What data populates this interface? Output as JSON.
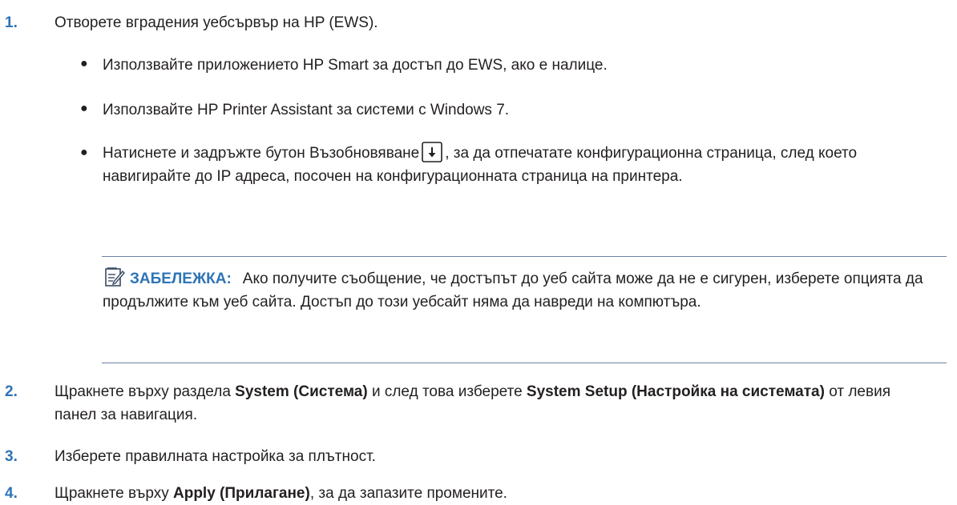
{
  "steps": [
    {
      "num": "1.",
      "text": "Отворете вградения уебсървър на HP (EWS)."
    },
    {
      "num": "2.",
      "text_a": "Щракнете върху раздела ",
      "bold_a": "System (Система)",
      "text_b": " и след това изберете ",
      "bold_b": "System Setup (Настройка на системата)",
      "text_c": " от левия панел за навигация."
    },
    {
      "num": "3.",
      "text": "Изберете правилната настройка за плътност."
    },
    {
      "num": "4.",
      "text_a": "Щракнете върху ",
      "bold_a": "Apply (Прилагане)",
      "text_b": ", за да запазите промените."
    }
  ],
  "bullets": [
    {
      "symbol": "●",
      "text": "Използвайте приложението HP Smart за достъп до EWS, ако е налице."
    },
    {
      "symbol": "●",
      "text": "Използвайте HP Printer Assistant за системи с Windows 7."
    },
    {
      "symbol": "●",
      "text_a": "Натиснете и задръжте бутон Възобновяване",
      "icon": "resume-button-icon",
      "text_b": ", за да отпечатате конфигурационна страница, след което навигирайте до IP адреса, посочен на конфигурационната страница на принтера."
    }
  ],
  "note": {
    "icon": "note-icon",
    "label": "ЗАБЕЛЕЖКА:",
    "text": "Ако получите съобщение, че достъпът до уеб сайта може да не е сигурен, изберете опцията да продължите към уеб сайта. Достъп до този уебсайт няма да навреди на компютъра."
  },
  "colors": {
    "accent": "#2e74b5",
    "text": "#231f20",
    "rule": "#6b7fa3"
  }
}
